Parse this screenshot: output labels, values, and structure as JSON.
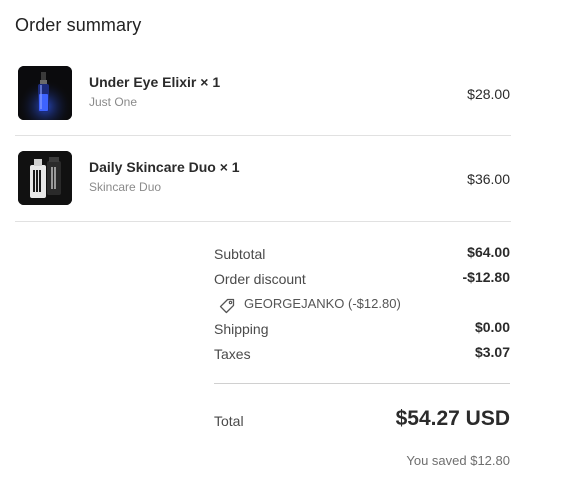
{
  "summary": {
    "title": "Order summary"
  },
  "items": [
    {
      "name": "Under Eye Elixir × 1",
      "variant": "Just One",
      "price": "$28.00",
      "thumbnail": "under-eye-elixir-bottle"
    },
    {
      "name": "Daily Skincare Duo × 1",
      "variant": "Skincare Duo",
      "price": "$36.00",
      "thumbnail": "skincare-duo-bottles"
    }
  ],
  "totals": {
    "subtotal_label": "Subtotal",
    "subtotal_value": "$64.00",
    "discount_label": "Order discount",
    "discount_value": "-$12.80",
    "discount_code": "GEORGEJANKO (-$12.80)",
    "shipping_label": "Shipping",
    "shipping_value": "$0.00",
    "taxes_label": "Taxes",
    "taxes_value": "$3.07",
    "total_label": "Total",
    "total_value": "$54.27 USD",
    "savings": "You saved $12.80"
  },
  "icons": {
    "discount": "tag-icon"
  },
  "colors": {
    "thumb_bg": "#0d0d0d",
    "divider": "#e1e1e1",
    "text": "#2b2b2b"
  }
}
